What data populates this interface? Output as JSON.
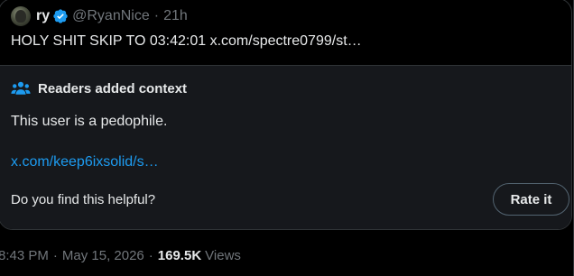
{
  "quoted_tweet": {
    "display_name": "ry",
    "handle": "@RyanNice",
    "separator": "·",
    "time": "21h",
    "text": "HOLY SHIT SKIP TO 03:42:01 x.com/spectre0799/st…"
  },
  "community_note": {
    "heading": "Readers added context",
    "body": "This user is a pedophile.",
    "link": "x.com/keep6ixsolid/s…",
    "helpful_question": "Do you find this helpful?",
    "rate_button_label": "Rate it"
  },
  "meta": {
    "time": "8:43 PM",
    "sep1": "·",
    "date": "May 15, 2026",
    "sep2": "·",
    "views_count": "169.5K",
    "views_label": "Views"
  },
  "colors": {
    "background": "#000000",
    "note_background": "#16181c",
    "link": "#1d9bf0",
    "verified": "#1d9bf0",
    "muted_text": "#71767b",
    "border": "#2f3336"
  },
  "icons": {
    "verified": "verified-badge-icon",
    "note": "people-icon"
  }
}
